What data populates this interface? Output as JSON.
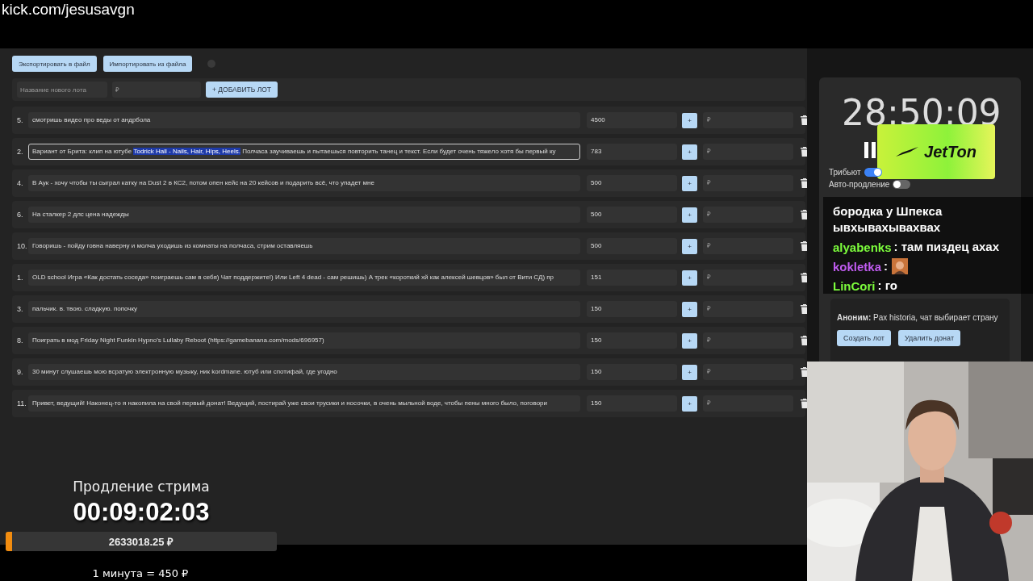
{
  "address": "kick.com/jesusavgn",
  "toolbar": {
    "buttons": [
      "Экспортировать в файл",
      "Импортировать из файла"
    ]
  },
  "new_lot": {
    "name_placeholder": "Название нового лота",
    "price_placeholder": "₽",
    "add_button": "+ ДОБАВИТЬ ЛОТ"
  },
  "lots": [
    {
      "number": "5.",
      "focused": false,
      "name": [
        {
          "text": "смотришь видео про веды от андрбола",
          "selected": false
        }
      ],
      "amount": "4500",
      "add_button": "+",
      "bid_placeholder": "₽"
    },
    {
      "number": "2.",
      "focused": true,
      "name": [
        {
          "text": "Вариант от Брита: клип на ютубе ",
          "selected": false
        },
        {
          "text": "Todrick Hall - Nails, Hair, Hips, Heels.",
          "selected": true
        },
        {
          "text": " Полчаса заучиваешь и пытаешься повторить танец и текст. Если будет очень тяжело хотя бы первый ку",
          "selected": false
        }
      ],
      "amount": "783",
      "add_button": "+",
      "bid_placeholder": "₽"
    },
    {
      "number": "4.",
      "focused": false,
      "name": [
        {
          "text": "В Аук - хочу чтобы ты сыграл катку на Dust 2 в КС2, потом опен кейс на 20 кейсов и подарить всё, что упадет мне",
          "selected": false
        }
      ],
      "amount": "500",
      "add_button": "+",
      "bid_placeholder": "₽"
    },
    {
      "number": "6.",
      "focused": false,
      "name": [
        {
          "text": "На сталкер 2 длс цена надежды",
          "selected": false
        }
      ],
      "amount": "500",
      "add_button": "+",
      "bid_placeholder": "₽"
    },
    {
      "number": "10.",
      "focused": false,
      "name": [
        {
          "text": "Говоришь - пойду говна наверну и молча уходишь из комнаты на полчаса, стрим оставляешь",
          "selected": false
        }
      ],
      "amount": "500",
      "add_button": "+",
      "bid_placeholder": "₽"
    },
    {
      "number": "1.",
      "focused": false,
      "name": [
        {
          "text": "OLD school Игра «Как достать соседа» поиграешь сам в себя) Чат поддержите!) Или Left 4 dead - сам решишь) А трек «короткий хй как алексей шевцов» был от Вити СД) пр",
          "selected": false
        }
      ],
      "amount": "151",
      "add_button": "+",
      "bid_placeholder": "₽"
    },
    {
      "number": "3.",
      "focused": false,
      "name": [
        {
          "text": "пальчик. в. твою. сладкую. попочку",
          "selected": false
        }
      ],
      "amount": "150",
      "add_button": "+",
      "bid_placeholder": "₽"
    },
    {
      "number": "8.",
      "focused": false,
      "name": [
        {
          "text": "Поиграть в мод Friday Night Funkin Hypno's Lullaby Reboot (https://gamebanana.com/mods/696957)",
          "selected": false
        }
      ],
      "amount": "150",
      "add_button": "+",
      "bid_placeholder": "₽"
    },
    {
      "number": "9.",
      "focused": false,
      "name": [
        {
          "text": "30 минут слушаешь мою всратую электронную музыку, ник kordmane. ютуб или спотифай, где угодно",
          "selected": false
        }
      ],
      "amount": "150",
      "add_button": "+",
      "bid_placeholder": "₽"
    },
    {
      "number": "11.",
      "focused": false,
      "name": [
        {
          "text": "Привет, ведущий! Наконец-то я накопила на свой первый донат! Ведущий, постирай уже свои трусики и носочки, в очень мыльной воде, чтобы пены много было, поговори",
          "selected": false
        }
      ],
      "amount": "150",
      "add_button": "+",
      "bid_placeholder": "₽"
    }
  ],
  "timer_panel": {
    "time": "28:50:09",
    "sponsor_logo": "JetTon",
    "toggles": [
      {
        "label": "Трибьют",
        "on": true
      },
      {
        "label": "Авто-продление",
        "on": false
      }
    ]
  },
  "chat": [
    {
      "kind": "continuation",
      "text": "бородка у Шпекса ывхывахывахвах"
    },
    {
      "kind": "text",
      "user": "alyabenks",
      "color": "#7cfc3c",
      "text": ": там пиздец ахах"
    },
    {
      "kind": "emote",
      "user": "kokletka",
      "color": "#c05cf0",
      "text": ":"
    },
    {
      "kind": "text",
      "user": "LinCori",
      "color": "#7cfc3c",
      "text": ": го"
    }
  ],
  "donation": {
    "message": "**Аноним:** Pax historia, чат выбирает страну",
    "buttons": [
      "Создать лот",
      "Удалить донат"
    ]
  },
  "extension": {
    "title": "Продление стрима",
    "time": "00:09:02:03",
    "amount": "2633018.25 ₽",
    "level": 0.015,
    "rate": "1 минута = 450 ₽"
  }
}
